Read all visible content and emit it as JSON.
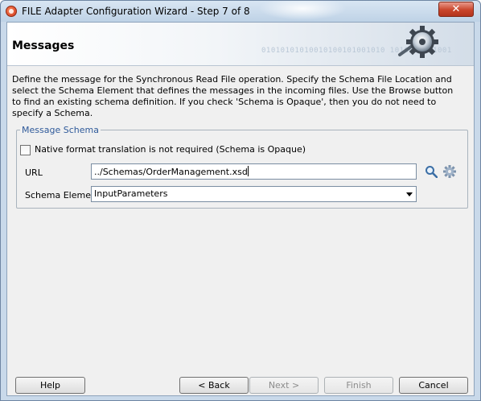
{
  "window": {
    "title": "FILE Adapter Configuration Wizard - Step 7 of 8",
    "close_label": "✕"
  },
  "header": {
    "title": "Messages",
    "decor_text": "01010101010010100101001010 1010010101001"
  },
  "description": "Define the message for the Synchronous Read File operation.  Specify the Schema File Location and select the Schema Element that defines the messages in the incoming files. Use the Browse button to find an existing schema definition. If you check 'Schema is Opaque', then you do not need to specify a Schema.",
  "message_schema": {
    "legend": "Message Schema",
    "opaque_checkbox": {
      "label": "Native format translation is not required (Schema is Opaque)",
      "checked": false
    },
    "url": {
      "label": "URL",
      "value": "../Schemas/OrderManagement.xsd"
    },
    "schema_element": {
      "label": "Schema Element",
      "value": "InputParameters"
    },
    "icons": {
      "browse": "search-icon",
      "generate": "gear-icon"
    }
  },
  "buttons": {
    "help": "Help",
    "back": "< Back",
    "next": "Next >",
    "finish": "Finish",
    "cancel": "Cancel"
  },
  "colors": {
    "title_bar": "#c9d9ea",
    "legend_text": "#2f5a9a",
    "close_button": "#c9452b"
  }
}
